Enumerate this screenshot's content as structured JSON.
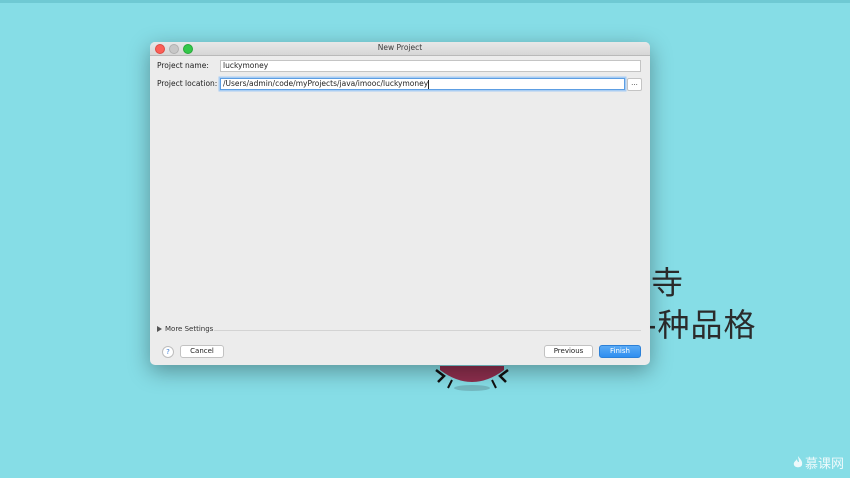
{
  "dialog": {
    "title": "New Project",
    "project_name_label": "Project name:",
    "project_name_value": "luckymoney",
    "project_location_label": "Project location:",
    "project_location_value": "/Users/admin/code/myProjects/java/imooc/luckymoney",
    "browse_label": "...",
    "more_settings_label": "More Settings",
    "help_label": "?",
    "cancel_label": "Cancel",
    "previous_label": "Previous",
    "finish_label": "Finish"
  },
  "background": {
    "text_line1": "寺",
    "text_line2": "-种品格",
    "watermark": "慕课网"
  },
  "colors": {
    "desktop": "#86dde6",
    "accent": "#2f8ef0"
  }
}
